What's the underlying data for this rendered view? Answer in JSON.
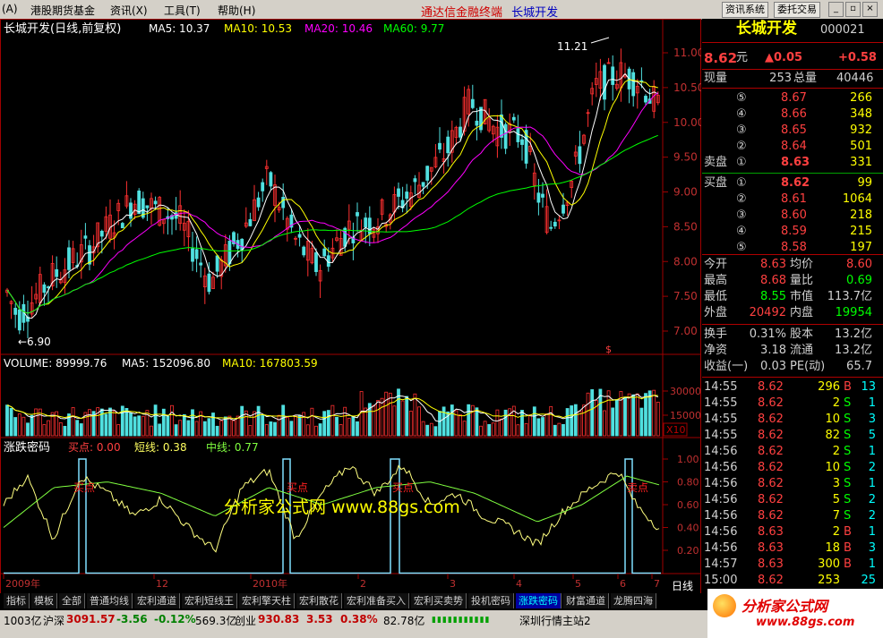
{
  "menu": {
    "items": [
      "(A)",
      "港股期货基金",
      "资讯(X)",
      "工具(T)",
      "帮助(H)"
    ],
    "center_title": "通达信金融终端",
    "center_stock": "长城开发",
    "btn_news": "资讯系统",
    "btn_trade": "委托交易"
  },
  "main_chart": {
    "title": "长城开发(日线,前复权)",
    "ma5": "MA5: 10.37",
    "ma10": "MA10: 10.53",
    "ma20": "MA20: 10.46",
    "ma60": "MA60: 9.77",
    "high_label": "11.21",
    "low_label": "←6.90",
    "y_ticks": [
      "11.00",
      "10.50",
      "10.00",
      "9.50",
      "9.00",
      "8.50",
      "8.00",
      "7.50",
      "7.00"
    ],
    "marker": "$"
  },
  "volume_chart": {
    "title": "VOLUME: 89999.76",
    "ma5": "MA5: 152096.80",
    "ma10": "MA10: 167803.59",
    "y_ticks": [
      "30000",
      "15000"
    ],
    "unit": "X10"
  },
  "indicator": {
    "title": "涨跌密码",
    "buy_point": "买点: 0.00",
    "short_line": "短线: 0.38",
    "mid_line": "中线: 0.77",
    "y_ticks": [
      "1.00",
      "0.80",
      "0.60",
      "0.40",
      "0.20"
    ],
    "labels": [
      "买点",
      "买点",
      "买点",
      "卖点"
    ],
    "watermark": "分析家公式网 www.88gs.com",
    "x_ticks": [
      "2009年",
      "12",
      "2010年",
      "2",
      "3",
      "4",
      "5",
      "6",
      "7"
    ],
    "period": "日线"
  },
  "quote": {
    "name": "长城开发",
    "code": "000021",
    "price": "8.62",
    "unit": "元",
    "change": "▲0.05",
    "change_pct": "+0.58",
    "xianliang_label": "现量",
    "xianliang": "253",
    "zongliang_label": "总量",
    "zongliang": "40446",
    "sell_label": "卖盘",
    "buy_label": "买盘",
    "sell": [
      {
        "idx": "⑤",
        "price": "8.67",
        "vol": "266"
      },
      {
        "idx": "④",
        "price": "8.66",
        "vol": "348"
      },
      {
        "idx": "③",
        "price": "8.65",
        "vol": "932"
      },
      {
        "idx": "②",
        "price": "8.64",
        "vol": "501"
      },
      {
        "idx": "①",
        "price": "8.63",
        "vol": "331"
      }
    ],
    "buy": [
      {
        "idx": "①",
        "price": "8.62",
        "vol": "99"
      },
      {
        "idx": "②",
        "price": "8.61",
        "vol": "1064"
      },
      {
        "idx": "③",
        "price": "8.60",
        "vol": "218"
      },
      {
        "idx": "④",
        "price": "8.59",
        "vol": "215"
      },
      {
        "idx": "⑤",
        "price": "8.58",
        "vol": "197"
      }
    ],
    "stats": [
      {
        "l1": "今开",
        "v1": "8.63",
        "l2": "均价",
        "v2": "8.60"
      },
      {
        "l1": "最高",
        "v1": "8.68",
        "l2": "量比",
        "v2": "0.69"
      },
      {
        "l1": "最低",
        "v1": "8.55",
        "l2": "市值",
        "v2": "113.7亿"
      },
      {
        "l1": "外盘",
        "v1": "20492",
        "l2": "内盘",
        "v2": "19954"
      }
    ],
    "stats2": [
      {
        "l1": "换手",
        "v1": "0.31%",
        "l2": "股本",
        "v2": "13.2亿"
      },
      {
        "l1": "净资",
        "v1": "3.18",
        "l2": "流通",
        "v2": "13.2亿"
      },
      {
        "l1": "收益(一)",
        "v1": "0.03",
        "l2": "PE(动)",
        "v2": "65.7"
      }
    ],
    "ticks": [
      {
        "t": "14:55",
        "p": "8.62",
        "v": "296",
        "bs": "B",
        "n": "13"
      },
      {
        "t": "14:55",
        "p": "8.62",
        "v": "2",
        "bs": "S",
        "n": "1"
      },
      {
        "t": "14:55",
        "p": "8.62",
        "v": "10",
        "bs": "S",
        "n": "3"
      },
      {
        "t": "14:55",
        "p": "8.62",
        "v": "82",
        "bs": "S",
        "n": "5"
      },
      {
        "t": "14:56",
        "p": "8.62",
        "v": "2",
        "bs": "S",
        "n": "1"
      },
      {
        "t": "14:56",
        "p": "8.62",
        "v": "10",
        "bs": "S",
        "n": "2"
      },
      {
        "t": "14:56",
        "p": "8.62",
        "v": "3",
        "bs": "S",
        "n": "1"
      },
      {
        "t": "14:56",
        "p": "8.62",
        "v": "5",
        "bs": "S",
        "n": "2"
      },
      {
        "t": "14:56",
        "p": "8.62",
        "v": "7",
        "bs": "S",
        "n": "2"
      },
      {
        "t": "14:56",
        "p": "8.63",
        "v": "2",
        "bs": "B",
        "n": "1"
      },
      {
        "t": "14:56",
        "p": "8.63",
        "v": "18",
        "bs": "B",
        "n": "3"
      },
      {
        "t": "14:57",
        "p": "8.63",
        "v": "300",
        "bs": "B",
        "n": "1"
      },
      {
        "t": "15:00",
        "p": "8.62",
        "v": "253",
        "bs": "",
        "n": "25"
      }
    ]
  },
  "tabs": [
    "指标",
    "模板",
    "全部",
    "普通均线",
    "宏利通道",
    "宏利短线王",
    "宏利擎天柱",
    "宏利散花",
    "宏利准备买入",
    "宏利买卖势",
    "投机密码",
    "涨跌密码",
    "财富通道",
    "龙腾四海"
  ],
  "status": {
    "s1": "1003亿",
    "s2_label": "沪深",
    "s2_val": "3091.57",
    "s3": "-3.56",
    "s4": "-0.12%",
    "s5": "569.3亿",
    "s6_label": "创业",
    "s6_val": "930.83",
    "s7": "3.53",
    "s8": "0.38%",
    "s9": "82.78亿",
    "s10": "深圳行情主站2"
  },
  "logo": {
    "text": "分析家公式网",
    "url": "www.88gs.com"
  },
  "colors": {
    "bg": "#000000",
    "up": "#ff3030",
    "down": "#50e0e0",
    "ma5": "#ffffff",
    "ma10": "#ffff00",
    "ma20": "#ff00ff",
    "ma60": "#00ff00",
    "grid": "#800000"
  }
}
